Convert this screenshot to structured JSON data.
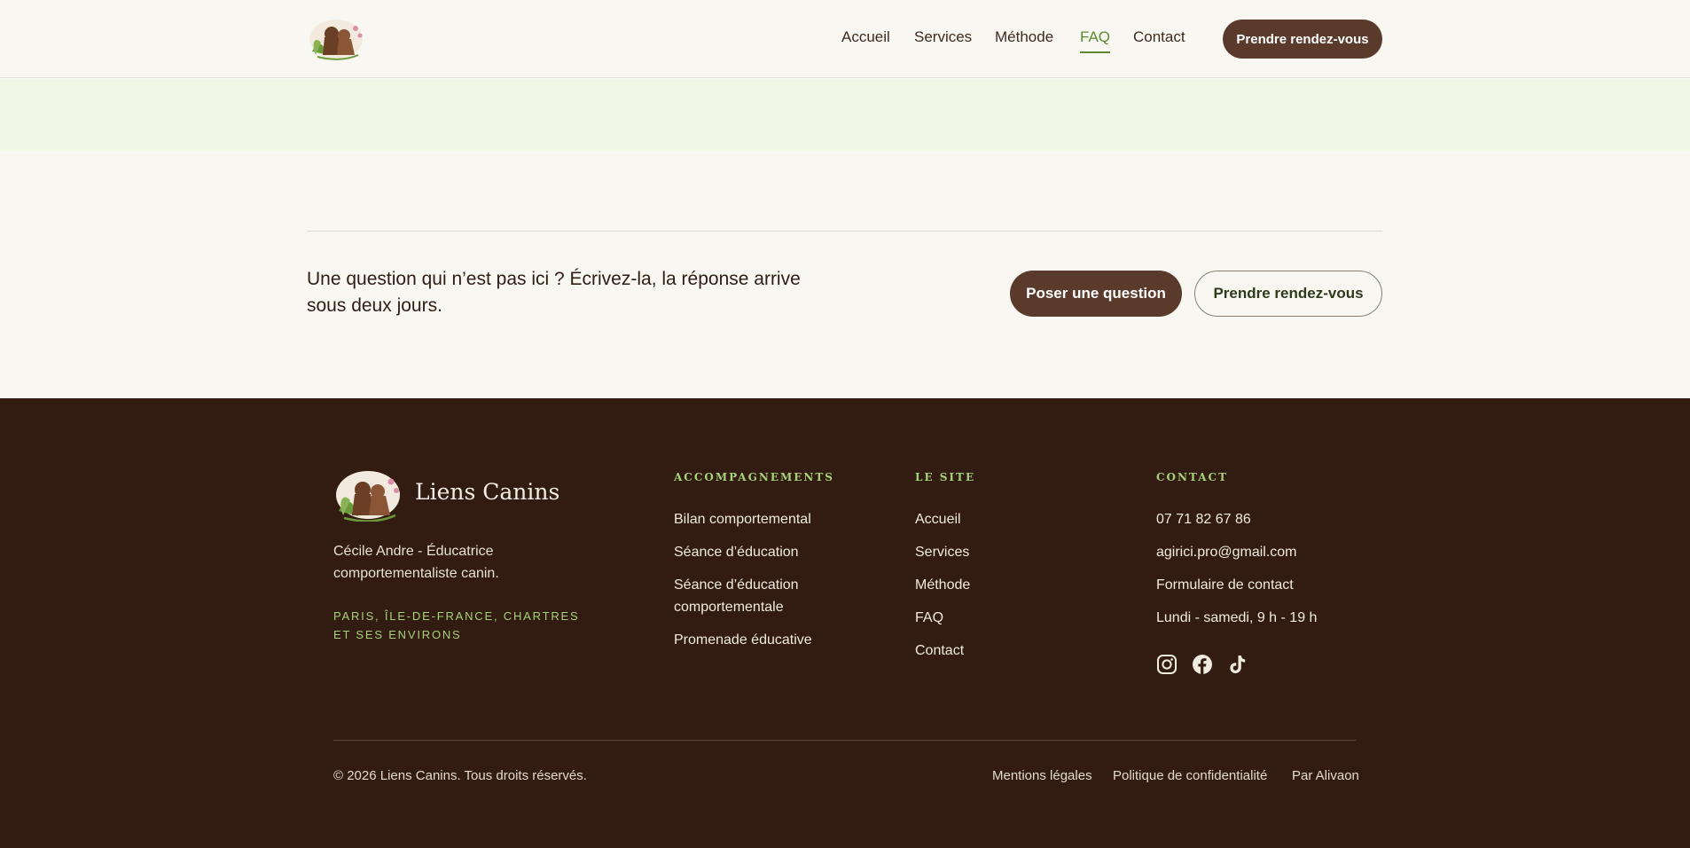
{
  "header": {
    "nav": [
      {
        "label": "Accueil",
        "active": false
      },
      {
        "label": "Services",
        "active": false
      },
      {
        "label": "Méthode",
        "active": false
      },
      {
        "label": "FAQ",
        "active": true
      },
      {
        "label": "Contact",
        "active": false
      }
    ],
    "cta_label": "Prendre rendez-vous"
  },
  "cta_section": {
    "text": "Une question qui n’est pas ici ? Écrivez-la, la réponse arrive sous deux jours.",
    "ask_button": "Poser une question",
    "rdv_button": "Prendre rendez-vous"
  },
  "footer": {
    "brand": "Liens Canins",
    "description": "Cécile Andre - Éducatrice comportementaliste canin.",
    "region": "PARIS, ÎLE-DE-FRANCE, CHARTRES ET SES ENVIRONS",
    "columns": [
      {
        "title": "ACCOMPAGNEMENTS",
        "links": [
          "Bilan comportemental",
          "Séance d’éducation",
          "Séance d’éducation comportementale",
          "Promenade éducative"
        ]
      },
      {
        "title": "LE SITE",
        "links": [
          "Accueil",
          "Services",
          "Méthode",
          "FAQ",
          "Contact"
        ]
      },
      {
        "title": "CONTACT",
        "links": [
          "07 71 82 67 86",
          "agirici.pro@gmail.com",
          "Formulaire de contact",
          "Lundi - samedi, 9 h - 19 h"
        ]
      }
    ],
    "socials": [
      "instagram-icon",
      "facebook-icon",
      "tiktok-icon"
    ],
    "copyright": "© 2026 Liens Canins. Tous droits réservés.",
    "legal": [
      "Mentions légales",
      "Politique de confidentialité",
      "Par Alivaon"
    ]
  },
  "colors": {
    "brown": "#5a3a2a",
    "footer_bg": "#321b10",
    "accent_green": "#a6d27a",
    "nav_active": "#5d8a2e",
    "band_green": "#f1f8e8"
  }
}
